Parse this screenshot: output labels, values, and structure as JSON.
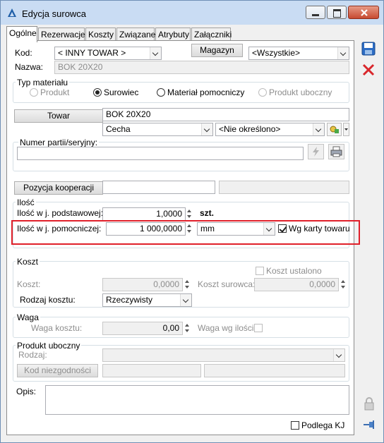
{
  "window": {
    "title": "Edycja surowca",
    "icon": "app-logo-icon"
  },
  "tabs": [
    "Ogólne",
    "Rezerwacje",
    "Koszty",
    "Związane",
    "Atrybuty",
    "Załączniki"
  ],
  "kod": {
    "label": "Kod:",
    "value": "< INNY TOWAR >"
  },
  "magazyn": {
    "button": "Magazyn",
    "value": "<Wszystkie>"
  },
  "nazwa": {
    "label": "Nazwa:",
    "value": "BOK 20X20"
  },
  "typ_materialu": {
    "legend": "Typ materiału",
    "options": [
      "Produkt",
      "Surowiec",
      "Materiał pomocniczy",
      "Produkt uboczny"
    ],
    "selected": "Surowiec"
  },
  "towar": {
    "button": "Towar",
    "value": "BOK 20X20",
    "cecha": "Cecha",
    "cecha_value": "<Nie określono>"
  },
  "numer_partii": {
    "label": "Numer partii/seryjny:",
    "value": ""
  },
  "pozycja_kooperacji": {
    "button": "Pozycja kooperacji",
    "value": "",
    "value2": ""
  },
  "ilosc": {
    "legend": "Ilość",
    "podstawowa_label": "Ilość w j. podstawowej:",
    "podstawowa_value": "1,0000",
    "podstawowa_unit": "szt.",
    "pomocnicza_label": "Ilość w j. pomocniczej:",
    "pomocnicza_value": "1 000,0000",
    "pomocnicza_unit": "mm",
    "wg_karty_label": "Wg karty towaru",
    "wg_karty_checked": true
  },
  "koszt": {
    "legend": "Koszt",
    "koszt_ustalony_label": "Koszt ustalono",
    "koszt_label": "Koszt:",
    "koszt_value": "0,0000",
    "koszt_surowca_label": "Koszt surowca:",
    "koszt_surowca_value": "0,0000",
    "rodzaj_label": "Rodzaj kosztu:",
    "rodzaj_value": "Rzeczywisty"
  },
  "waga": {
    "legend": "Waga",
    "waga_kosztu_label": "Waga kosztu:",
    "waga_kosztu_value": "0,00",
    "waga_wg_ilosci_label": "Waga wg ilości:"
  },
  "produkt_uboczny": {
    "legend": "Produkt uboczny",
    "rodzaj_label": "Rodzaj:",
    "rodzaj_value": "",
    "kod_niezgodnosci_button": "Kod niezgodności",
    "kod_value": ""
  },
  "opis": {
    "label": "Opis:",
    "value": ""
  },
  "podlega_kj": {
    "label": "Podlega KJ",
    "checked": false
  }
}
